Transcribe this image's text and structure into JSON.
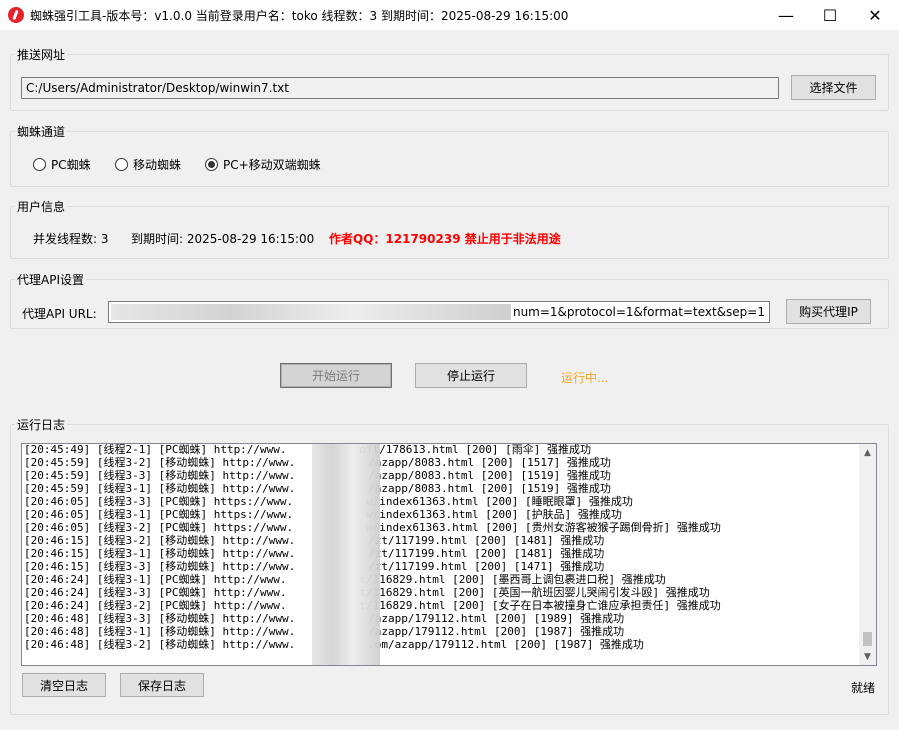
{
  "window": {
    "title": "蜘蛛强引工具-版本号：v1.0.0 当前登录用户名：toko 线程数：3 到期时间：2025-08-29 16:15:00",
    "minimize": "—",
    "maximize": "☐",
    "close": "✕"
  },
  "push_url": {
    "group_title": "推送网址",
    "path_value": "C:/Users/Administrator/Desktop/winwin7.txt",
    "choose_file_label": "选择文件"
  },
  "spider_channel": {
    "group_title": "蜘蛛通道",
    "options": [
      {
        "label": "PC蜘蛛",
        "selected": false
      },
      {
        "label": "移动蜘蛛",
        "selected": false
      },
      {
        "label": "PC+移动双端蜘蛛",
        "selected": true
      }
    ]
  },
  "user_info": {
    "group_title": "用户信息",
    "threads_text": "并发线程数: 3",
    "expiry_text": "到期时间: 2025-08-29 16:15:00",
    "author_notice": "作者QQ：121790239 禁止用于非法用途"
  },
  "proxy": {
    "group_title": "代理API设置",
    "url_label": "代理API URL:",
    "url_value_visible": "num=1&protocol=1&format=text&sep=1",
    "buy_label": "购买代理IP"
  },
  "controls": {
    "start_label": "开始运行",
    "stop_label": "停止运行",
    "status_text": "运行中..."
  },
  "log": {
    "group_title": "运行日志",
    "lines": [
      "[20:45:49] [线程2-1] [PC蜘蛛] http://www.           oft/178613.html [200] [雨伞] 强推成功",
      "[20:45:59] [线程3-2] [移动蜘蛛] http://www.           /azapp/8083.html [200] [1517] 强推成功",
      "[20:45:59] [线程3-3] [移动蜘蛛] http://www.           /azapp/8083.html [200] [1519] 强推成功",
      "[20:45:59] [线程3-1] [移动蜘蛛] http://www.           /azapp/8083.html [200] [1519] 强推成功",
      "[20:46:05] [线程3-3] [PC蜘蛛] https://www.           w/index61363.html [200] [睡眠眼罩] 强推成功",
      "[20:46:05] [线程3-1] [PC蜘蛛] https://www.           w/index61363.html [200] [护肤品] 强推成功",
      "[20:46:05] [线程3-2] [PC蜘蛛] https://www.           w/index61363.html [200] [贵州女游客被猴子踢倒骨折] 强推成功",
      "[20:46:15] [线程3-2] [移动蜘蛛] http://www.           /zt/117199.html [200] [1481] 强推成功",
      "[20:46:15] [线程3-1] [移动蜘蛛] http://www.           /zt/117199.html [200] [1481] 强推成功",
      "[20:46:15] [线程3-3] [移动蜘蛛] http://www.           /zt/117199.html [200] [1471] 强推成功",
      "[20:46:24] [线程3-1] [PC蜘蛛] http://www.           t/116829.html [200] [墨西哥上调包裹进口税] 强推成功",
      "[20:46:24] [线程3-3] [PC蜘蛛] http://www.           t/116829.html [200] [英国一航班因婴儿哭闹引发斗殴] 强推成功",
      "[20:46:24] [线程3-2] [PC蜘蛛] http://www.           t/116829.html [200] [女子在日本被撞身亡谁应承担责任] 强推成功",
      "[20:46:48] [线程3-3] [移动蜘蛛] http://www.           /azapp/179112.html [200] [1989] 强推成功",
      "[20:46:48] [线程3-1] [移动蜘蛛] http://www.           /azapp/179112.html [200] [1987] 强推成功",
      "[20:46:48] [线程3-2] [移动蜘蛛] http://www.           .om/azapp/179112.html [200] [1987] 强推成功"
    ],
    "clear_label": "清空日志",
    "save_label": "保存日志",
    "ready_text": "就绪"
  }
}
